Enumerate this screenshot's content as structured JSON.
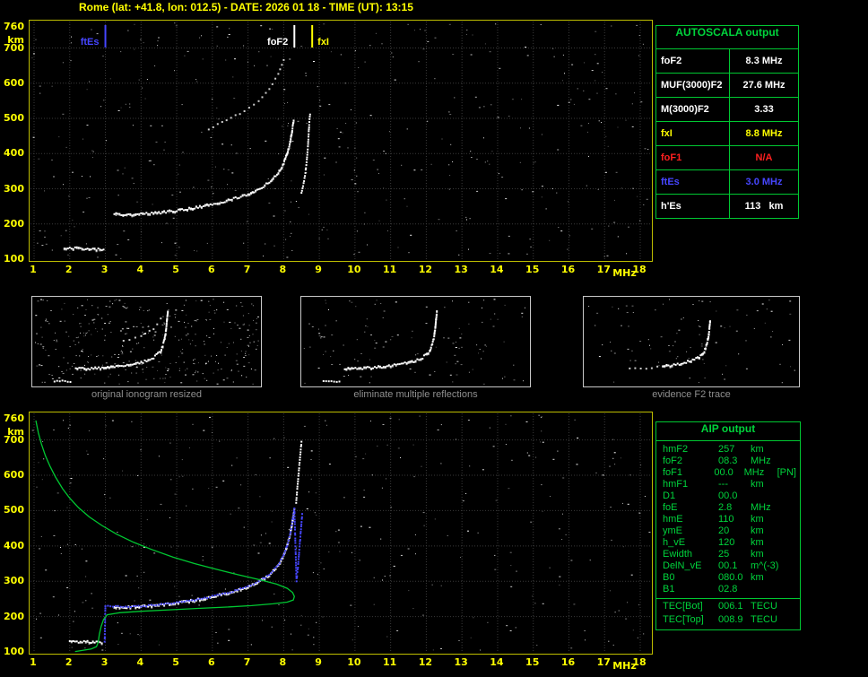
{
  "title": "Rome (lat: +41.8, lon: 012.5) - DATE: 2026 01 18 - TIME (UT): 13:15",
  "station": {
    "name": "Rome",
    "lat": "+41.8",
    "lon": "012.5",
    "date": "2026 01 18",
    "time_ut": "13:15"
  },
  "colors": {
    "white": "#ffffff",
    "yellow": "#ffff00",
    "red": "#ff2020",
    "blue": "#4646ff",
    "green": "#00c832",
    "grid": "#6a6a6a",
    "plot_border": "#bdbd00",
    "caption": "#8f8f8f",
    "background": "#000000"
  },
  "tables": {
    "autoscala": {
      "header": "AUTOSCALA output",
      "rows": [
        {
          "label": "foF2",
          "value": "8.3 MHz",
          "color": "white"
        },
        {
          "label": "MUF(3000)F2",
          "value": "27.6 MHz",
          "color": "white"
        },
        {
          "label": "M(3000)F2",
          "value": "3.33",
          "color": "white"
        },
        {
          "label": "fxI",
          "value": "8.8 MHz",
          "color": "yellow"
        },
        {
          "label": "foF1",
          "value": "N/A",
          "color": "red"
        },
        {
          "label": "ftEs",
          "value": "3.0 MHz",
          "color": "blue"
        },
        {
          "label": "h'Es",
          "value": "113   km",
          "color": "white"
        }
      ]
    },
    "aip": {
      "header": "AIP output",
      "rows": [
        {
          "name": "hmF2",
          "value": "257",
          "unit": "km",
          "note": ""
        },
        {
          "name": "foF2",
          "value": "08.3",
          "unit": "MHz",
          "note": ""
        },
        {
          "name": "foF1",
          "value": "00.0",
          "unit": "MHz",
          "note": "[PN]"
        },
        {
          "name": "hmF1",
          "value": "---",
          "unit": "km",
          "note": ""
        },
        {
          "name": "D1",
          "value": "00.0",
          "unit": "",
          "note": ""
        },
        {
          "name": "foE",
          "value": "2.8",
          "unit": "MHz",
          "note": ""
        },
        {
          "name": "hmE",
          "value": "110",
          "unit": "km",
          "note": ""
        },
        {
          "name": "ymE",
          "value": "20",
          "unit": "km",
          "note": ""
        },
        {
          "name": "h_vE",
          "value": "120",
          "unit": "km",
          "note": ""
        },
        {
          "name": "Ewidth",
          "value": "25",
          "unit": "km",
          "note": ""
        },
        {
          "name": "DelN_vE",
          "value": "00.1",
          "unit": "m^(-3)",
          "note": ""
        },
        {
          "name": "B0",
          "value": "080.0",
          "unit": "km",
          "note": ""
        },
        {
          "name": "B1",
          "value": "02.8",
          "unit": "",
          "note": ""
        },
        {
          "name": "TEC[Bot]",
          "value": "006.1",
          "unit": "TECU",
          "note": "",
          "sep": true
        },
        {
          "name": "TEC[Top]",
          "value": "008.9",
          "unit": "TECU",
          "note": ""
        }
      ]
    }
  },
  "thumbnails": [
    {
      "caption": "original ionogram resized"
    },
    {
      "caption": "eliminate multiple reflections"
    },
    {
      "caption": "evidence F2 trace"
    }
  ],
  "chart_data": [
    {
      "id": "ionogram-top",
      "type": "scatter",
      "title": "scaled ionogram",
      "xlabel": "MHz",
      "ylabel": "km",
      "xlim": [
        1,
        18
      ],
      "ylim": [
        100,
        760
      ],
      "x_ticks": [
        1,
        2,
        3,
        4,
        5,
        6,
        7,
        8,
        9,
        10,
        11,
        12,
        13,
        14,
        15,
        16,
        17,
        18
      ],
      "y_ticks": [
        760,
        700,
        600,
        500,
        400,
        300,
        200,
        100
      ],
      "grid": true,
      "show_axes": true,
      "noise_dots": 420,
      "markers": [
        {
          "label": "ftEs",
          "f": 3.0,
          "color": "blue",
          "side": "left"
        },
        {
          "label": "foF2",
          "f": 8.3,
          "color": "white",
          "side": "left"
        },
        {
          "label": "fxI",
          "f": 8.8,
          "color": "yellow",
          "side": "right"
        }
      ],
      "series": [
        {
          "name": "es-trace",
          "color": "#ffffff",
          "style": "dots-thick",
          "points": [
            [
              1.85,
              132
            ],
            [
              2.3,
              130
            ],
            [
              2.7,
              128
            ],
            [
              2.95,
              127
            ]
          ]
        },
        {
          "name": "f2-trace-ordinary",
          "color": "#ffffff",
          "style": "dots-thick",
          "points": [
            [
              3.25,
              230
            ],
            [
              3.6,
              226
            ],
            [
              4.0,
              228
            ],
            [
              4.5,
              232
            ],
            [
              5.0,
              238
            ],
            [
              5.5,
              246
            ],
            [
              6.0,
              256
            ],
            [
              6.5,
              268
            ],
            [
              7.0,
              284
            ],
            [
              7.3,
              298
            ],
            [
              7.6,
              318
            ],
            [
              7.85,
              345
            ],
            [
              8.0,
              372
            ],
            [
              8.1,
              400
            ],
            [
              8.18,
              432
            ],
            [
              8.24,
              465
            ],
            [
              8.28,
              495
            ]
          ]
        },
        {
          "name": "f2-trace-extraordinary",
          "color": "#ffffff",
          "style": "dots",
          "points": [
            [
              8.5,
              288
            ],
            [
              8.56,
              315
            ],
            [
              8.61,
              345
            ],
            [
              8.65,
              382
            ],
            [
              8.68,
              420
            ],
            [
              8.7,
              455
            ],
            [
              8.72,
              490
            ],
            [
              8.74,
              510
            ]
          ]
        },
        {
          "name": "second-hop-trace",
          "color": "#ffffff",
          "style": "dots-sparse",
          "points": [
            [
              5.9,
              470
            ],
            [
              6.4,
              495
            ],
            [
              6.9,
              520
            ],
            [
              7.3,
              550
            ],
            [
              7.6,
              585
            ],
            [
              7.85,
              625
            ],
            [
              8.0,
              665
            ]
          ]
        }
      ]
    },
    {
      "id": "ionogram-bottom",
      "type": "scatter",
      "title": "restored trace with AIP profile",
      "xlabel": "MHz",
      "ylabel": "km",
      "xlim": [
        1,
        18
      ],
      "ylim": [
        100,
        760
      ],
      "x_ticks": [
        1,
        2,
        3,
        4,
        5,
        6,
        7,
        8,
        9,
        10,
        11,
        12,
        13,
        14,
        15,
        16,
        17,
        18
      ],
      "y_ticks": [
        760,
        700,
        600,
        500,
        400,
        300,
        200,
        100
      ],
      "grid": true,
      "show_axes": true,
      "noise_dots": 320,
      "markers": [],
      "series": [
        {
          "name": "es-trace",
          "color": "#ffffff",
          "style": "dots-thick",
          "points": [
            [
              2.0,
              130
            ],
            [
              2.5,
              128
            ],
            [
              2.9,
              126
            ]
          ]
        },
        {
          "name": "f2-trace-restored",
          "color": "#ffffff",
          "style": "dots-thick",
          "points": [
            [
              3.25,
              228
            ],
            [
              3.6,
              226
            ],
            [
              4.0,
              228
            ],
            [
              4.5,
              232
            ],
            [
              5.0,
              238
            ],
            [
              5.5,
              246
            ],
            [
              6.0,
              256
            ],
            [
              6.5,
              268
            ],
            [
              7.0,
              284
            ],
            [
              7.3,
              298
            ],
            [
              7.6,
              318
            ],
            [
              7.85,
              345
            ],
            [
              8.0,
              372
            ],
            [
              8.1,
              400
            ],
            [
              8.18,
              432
            ],
            [
              8.24,
              465
            ],
            [
              8.3,
              505
            ]
          ]
        },
        {
          "name": "f2-asymptote",
          "color": "#ffffff",
          "style": "dots",
          "points": [
            [
              8.35,
              520
            ],
            [
              8.38,
              560
            ],
            [
              8.42,
              605
            ],
            [
              8.46,
              650
            ],
            [
              8.5,
              695
            ]
          ]
        },
        {
          "name": "scaled-points",
          "color": "#4646ff",
          "style": "dots",
          "points": [
            [
              2.98,
              128
            ],
            [
              3.0,
              230
            ],
            [
              3.5,
              227
            ],
            [
              4.0,
              229
            ],
            [
              4.5,
              233
            ],
            [
              5.0,
              239
            ],
            [
              5.5,
              247
            ],
            [
              6.0,
              257
            ],
            [
              6.5,
              269
            ],
            [
              7.0,
              285
            ],
            [
              7.3,
              299
            ],
            [
              7.6,
              319
            ],
            [
              7.85,
              346
            ],
            [
              8.0,
              373
            ],
            [
              8.1,
              401
            ],
            [
              8.18,
              433
            ],
            [
              8.24,
              466
            ],
            [
              8.3,
              506
            ],
            [
              8.36,
              300
            ],
            [
              8.4,
              340
            ],
            [
              8.44,
              390
            ],
            [
              8.48,
              440
            ],
            [
              8.52,
              490
            ]
          ]
        },
        {
          "name": "density-profile",
          "color": "#00c832",
          "style": "line",
          "points": [
            [
              1.05,
              755
            ],
            [
              1.12,
              720
            ],
            [
              1.2,
              690
            ],
            [
              1.32,
              655
            ],
            [
              1.45,
              625
            ],
            [
              1.6,
              595
            ],
            [
              1.8,
              562
            ],
            [
              2.0,
              535
            ],
            [
              2.25,
              508
            ],
            [
              2.55,
              482
            ],
            [
              2.9,
              458
            ],
            [
              3.3,
              434
            ],
            [
              3.8,
              410
            ],
            [
              4.3,
              390
            ],
            [
              4.9,
              368
            ],
            [
              5.5,
              350
            ],
            [
              6.1,
              334
            ],
            [
              6.7,
              319
            ],
            [
              7.3,
              305
            ],
            [
              7.8,
              292
            ],
            [
              8.1,
              280
            ],
            [
              8.25,
              268
            ],
            [
              8.3,
              257
            ],
            [
              8.27,
              247
            ],
            [
              8.1,
              241
            ],
            [
              7.7,
              236
            ],
            [
              7.1,
              231
            ],
            [
              6.4,
              227
            ],
            [
              5.6,
              223
            ],
            [
              4.8,
              219
            ],
            [
              4.0,
              215
            ],
            [
              3.4,
              211
            ],
            [
              3.05,
              205
            ],
            [
              2.95,
              192
            ],
            [
              2.88,
              172
            ],
            [
              2.83,
              150
            ],
            [
              2.8,
              128
            ],
            [
              2.75,
              115
            ],
            [
              2.6,
              108
            ],
            [
              2.35,
              104
            ],
            [
              2.15,
              101
            ]
          ]
        }
      ]
    },
    {
      "id": "thumb-original",
      "type": "scatter",
      "xlim": [
        1,
        13
      ],
      "ylim": [
        100,
        760
      ],
      "x_ticks": [],
      "y_ticks": [],
      "grid": false,
      "show_axes": false,
      "thumbnail": true,
      "noise_dots": 360,
      "markers": [],
      "series": [
        {
          "name": "es-trace",
          "color": "#ffffff",
          "style": "dots",
          "points": [
            [
              2.0,
              130
            ],
            [
              2.9,
              127
            ]
          ]
        },
        {
          "name": "f2-trace",
          "color": "#ffffff",
          "style": "dots-thick",
          "points": [
            [
              3.2,
              228
            ],
            [
              4.0,
              230
            ],
            [
              5.0,
              240
            ],
            [
              6.0,
              256
            ],
            [
              7.0,
              284
            ],
            [
              7.6,
              318
            ],
            [
              8.0,
              372
            ],
            [
              8.15,
              430
            ],
            [
              8.25,
              490
            ],
            [
              8.3,
              545
            ],
            [
              8.35,
              620
            ],
            [
              8.4,
              690
            ]
          ]
        },
        {
          "name": "second-hop",
          "color": "#ffffff",
          "style": "dots-sparse",
          "points": [
            [
              5.9,
              450
            ],
            [
              6.9,
              495
            ],
            [
              7.6,
              550
            ],
            [
              8.0,
              630
            ]
          ]
        }
      ]
    },
    {
      "id": "thumb-no-multiples",
      "type": "scatter",
      "xlim": [
        1,
        13
      ],
      "ylim": [
        100,
        760
      ],
      "x_ticks": [],
      "y_ticks": [],
      "grid": false,
      "show_axes": false,
      "thumbnail": true,
      "noise_dots": 120,
      "markers": [],
      "series": [
        {
          "name": "es-trace",
          "color": "#ffffff",
          "style": "dots",
          "points": [
            [
              2.0,
              130
            ],
            [
              2.9,
              127
            ]
          ]
        },
        {
          "name": "f2-trace",
          "color": "#ffffff",
          "style": "dots-thick",
          "points": [
            [
              3.2,
              228
            ],
            [
              4.0,
              230
            ],
            [
              5.0,
              240
            ],
            [
              6.0,
              256
            ],
            [
              7.0,
              284
            ],
            [
              7.6,
              318
            ],
            [
              8.0,
              372
            ],
            [
              8.15,
              430
            ],
            [
              8.25,
              490
            ],
            [
              8.3,
              545
            ],
            [
              8.35,
              620
            ],
            [
              8.4,
              690
            ]
          ]
        }
      ]
    },
    {
      "id": "thumb-f2-evidence",
      "type": "scatter",
      "xlim": [
        1,
        13
      ],
      "ylim": [
        100,
        760
      ],
      "x_ticks": [],
      "y_ticks": [],
      "grid": false,
      "show_axes": false,
      "thumbnail": true,
      "noise_dots": 90,
      "markers": [],
      "series": [
        {
          "name": "f2-lower-faint",
          "color": "#ffffff",
          "style": "dots-sparse",
          "points": [
            [
              3.5,
              227
            ],
            [
              4.5,
              232
            ],
            [
              5.5,
              246
            ]
          ]
        },
        {
          "name": "f2-trace",
          "color": "#ffffff",
          "style": "dots-thick",
          "points": [
            [
              5.5,
              246
            ],
            [
              6.5,
              268
            ],
            [
              7.2,
              292
            ],
            [
              7.7,
              325
            ],
            [
              8.0,
              372
            ],
            [
              8.15,
              430
            ],
            [
              8.25,
              490
            ],
            [
              8.3,
              545
            ],
            [
              8.35,
              620
            ]
          ]
        }
      ]
    }
  ]
}
